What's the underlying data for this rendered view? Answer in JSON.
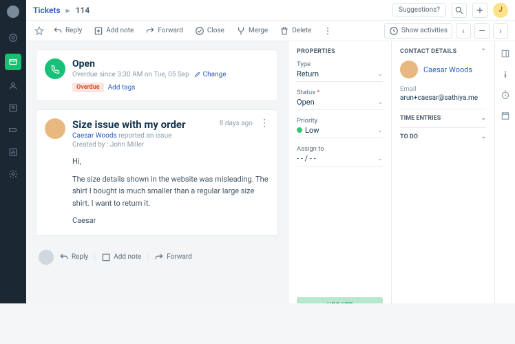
{
  "breadcrumb": {
    "root": "Tickets",
    "id": "114"
  },
  "topbar": {
    "suggestions": "Suggestions?",
    "avatar_initial": "J"
  },
  "actions": {
    "reply": "Reply",
    "addnote": "Add note",
    "forward": "Forward",
    "close": "Close",
    "merge": "Merge",
    "delete": "Delete",
    "show_activities": "Show activities"
  },
  "status_card": {
    "title": "Open",
    "subtitle": "Overdue since 3:30 AM on Tue, 05 Sep",
    "change": "Change",
    "overdue_tag": "Overdue",
    "add_tags": "Add tags"
  },
  "ticket": {
    "subject": "Size issue with my order",
    "requester": "Caesar Woods",
    "reported": "reported an issue",
    "created_by": "Created by : John Miller",
    "age": "8 days ago",
    "greeting": "Hi,",
    "body": "The size details shown in the website was misleading. The shirt I bought is much smaller than a regular large size shirt. I want to return it.",
    "signoff": "Caesar"
  },
  "reply_row": {
    "reply": "Reply",
    "addnote": "Add note",
    "forward": "Forward"
  },
  "properties": {
    "title": "PROPERTIES",
    "type_label": "Type",
    "type_val": "Return",
    "status_label": "Status",
    "status_val": "Open",
    "priority_label": "Priority",
    "priority_val": "Low",
    "assign_label": "Assign to",
    "assign_val": "- - / - -",
    "update": "UPDATE"
  },
  "contact": {
    "title": "CONTACT DETAILS",
    "name": "Caesar Woods",
    "email_label": "Email",
    "email_val": "arun+caesar@sathiya.me",
    "time_entries": "TIME ENTRIES",
    "todo": "TO DO"
  }
}
